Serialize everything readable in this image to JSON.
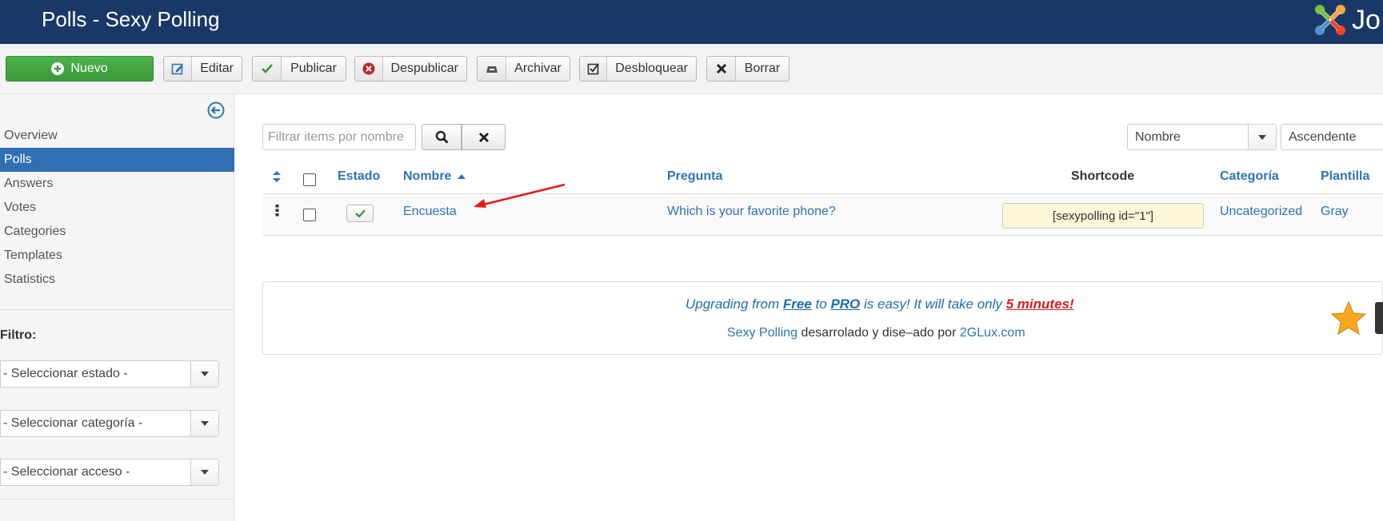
{
  "header": {
    "title": "Polls - Sexy Polling"
  },
  "toolbar": {
    "new_label": "Nuevo",
    "edit_label": "Editar",
    "publish_label": "Publicar",
    "unpublish_label": "Despublicar",
    "archive_label": "Archivar",
    "unlock_label": "Desbloquear",
    "delete_label": "Borrar"
  },
  "sidebar": {
    "items": [
      {
        "label": "Overview"
      },
      {
        "label": "Polls"
      },
      {
        "label": "Answers"
      },
      {
        "label": "Votes"
      },
      {
        "label": "Categories"
      },
      {
        "label": "Templates"
      },
      {
        "label": "Statistics"
      }
    ],
    "active_item": "Polls",
    "filter_title": "Filtro:",
    "filters": {
      "state": "- Seleccionar estado -",
      "category": "- Seleccionar categoría -",
      "access": "- Seleccionar acceso -"
    }
  },
  "search": {
    "placeholder": "Filtrar items por nombre",
    "value": ""
  },
  "sort": {
    "field": "Nombre",
    "direction": "Ascendente"
  },
  "table": {
    "columns": {
      "status": "Estado",
      "name": "Nombre",
      "question": "Pregunta",
      "shortcode": "Shortcode",
      "category": "Categoría",
      "template": "Plantilla"
    },
    "rows": [
      {
        "name": "Encuesta",
        "question": "Which is your favorite phone?",
        "shortcode": "[sexypolling id=\"1\"]",
        "category": "Uncategorized",
        "template": "Gray"
      }
    ]
  },
  "promo": {
    "text_1": "Upgrading from ",
    "free": "Free",
    "text_2": " to ",
    "pro": "PRO",
    "text_3": " is easy! It will take only ",
    "minutes": "5 minutes!",
    "credits_link_1": "Sexy Polling",
    "credits_mid": " desarrolado y dise–ado por ",
    "credits_link_2": "2GLux.com"
  },
  "colors": {
    "header_bg": "#1a3867",
    "active_nav": "#2f6fb2",
    "link": "#2e73b8",
    "new_button": "#3fa53d",
    "promo_red": "#d21f1f"
  }
}
